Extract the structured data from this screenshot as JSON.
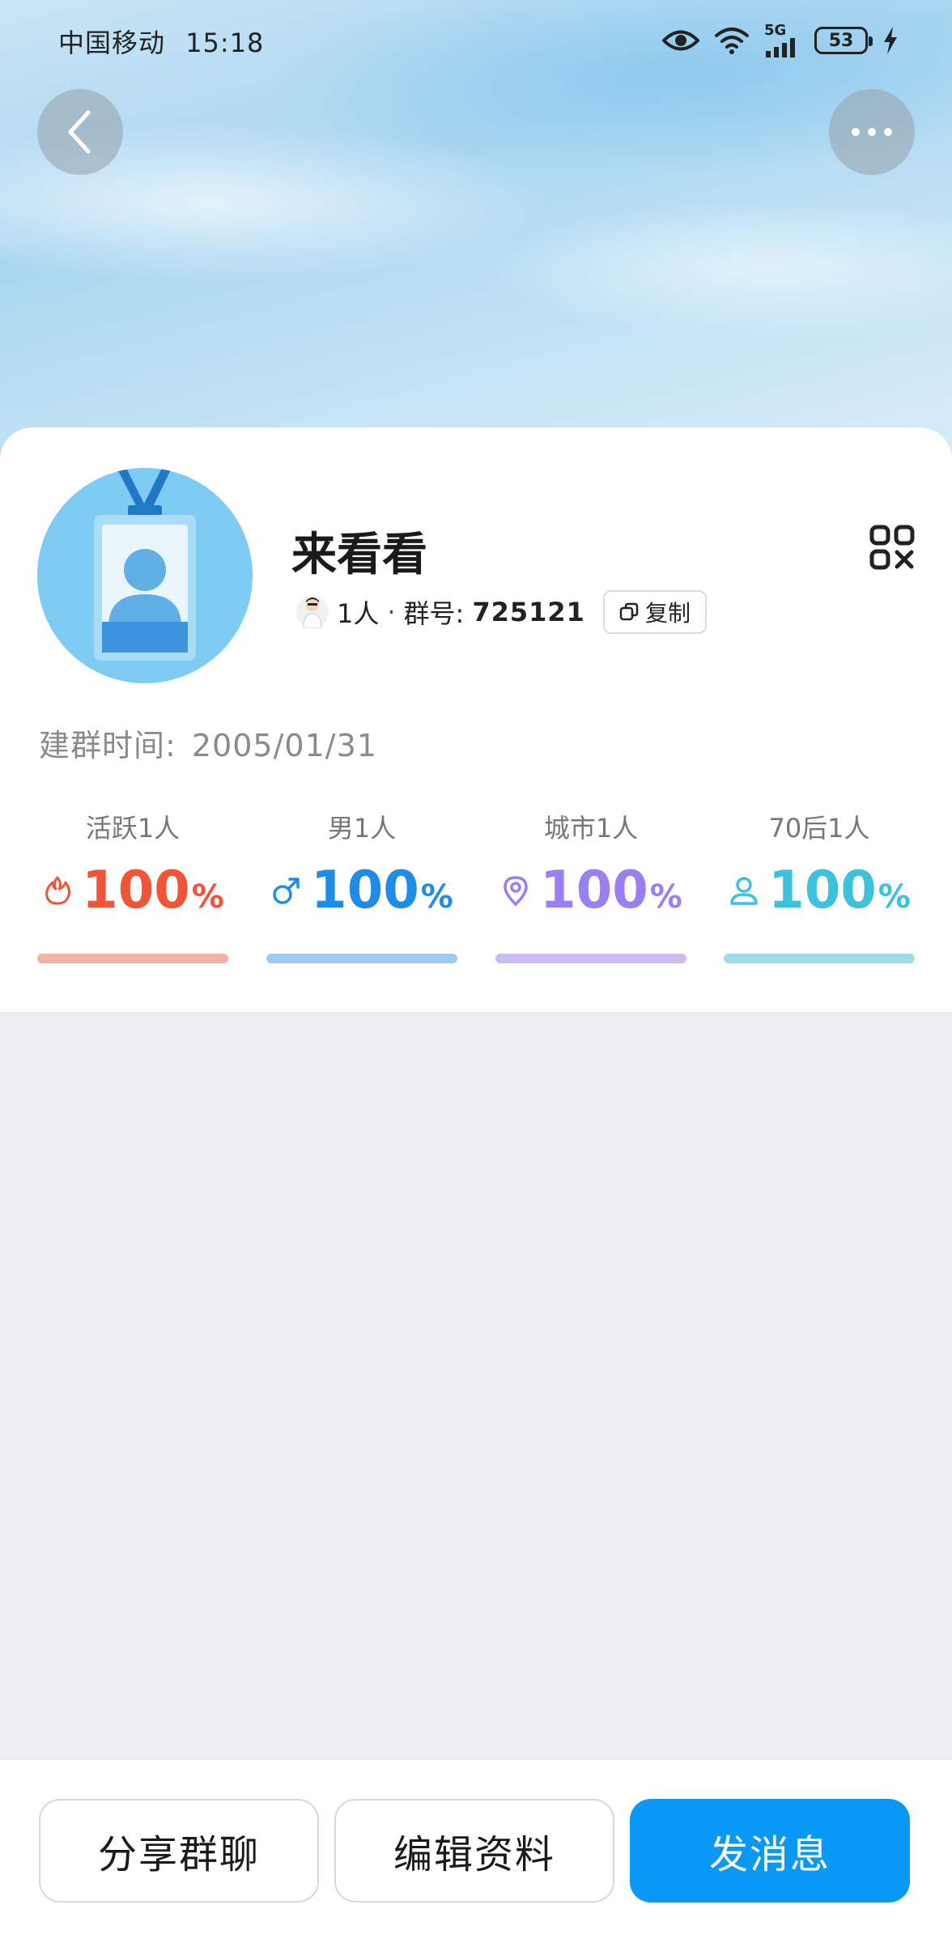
{
  "status_bar": {
    "carrier": "中国移动",
    "time": "15:18",
    "network": "5G",
    "battery": "53"
  },
  "header": {
    "back_icon": "chevron-left-icon",
    "more_icon": "ellipsis-icon"
  },
  "group": {
    "name": "来看看",
    "member_count": "1人",
    "separator": "·",
    "id_label": "群号:",
    "id_value": "725121",
    "copy_label": "复制",
    "qr_icon": "qr-code-icon",
    "created_label": "建群时间:",
    "created_value": "2005/01/31"
  },
  "stats": [
    {
      "label": "活跃1人",
      "value": "100",
      "unit": "%",
      "icon": "flame-icon",
      "color": "#f0553a",
      "bar_color": "#f7b2a3",
      "fraction": 1.0
    },
    {
      "label": "男1人",
      "value": "100",
      "unit": "%",
      "icon": "male-icon",
      "color": "#1f8de8",
      "bar_color": "#9ec9f3",
      "fraction": 1.0
    },
    {
      "label": "城市1人",
      "value": "100",
      "unit": "%",
      "icon": "location-pin-icon",
      "color": "#9b7ef0",
      "bar_color": "#cbbcf4",
      "fraction": 1.0
    },
    {
      "label": "70后1人",
      "value": "100",
      "unit": "%",
      "icon": "person-icon",
      "color": "#3dc1dd",
      "bar_color": "#9ddcea",
      "fraction": 1.0
    }
  ],
  "actions": {
    "share_label": "分享群聊",
    "edit_label": "编辑资料",
    "message_label": "发消息"
  },
  "colors": {
    "primary": "#0a98f7",
    "background": "#eeeef2"
  }
}
